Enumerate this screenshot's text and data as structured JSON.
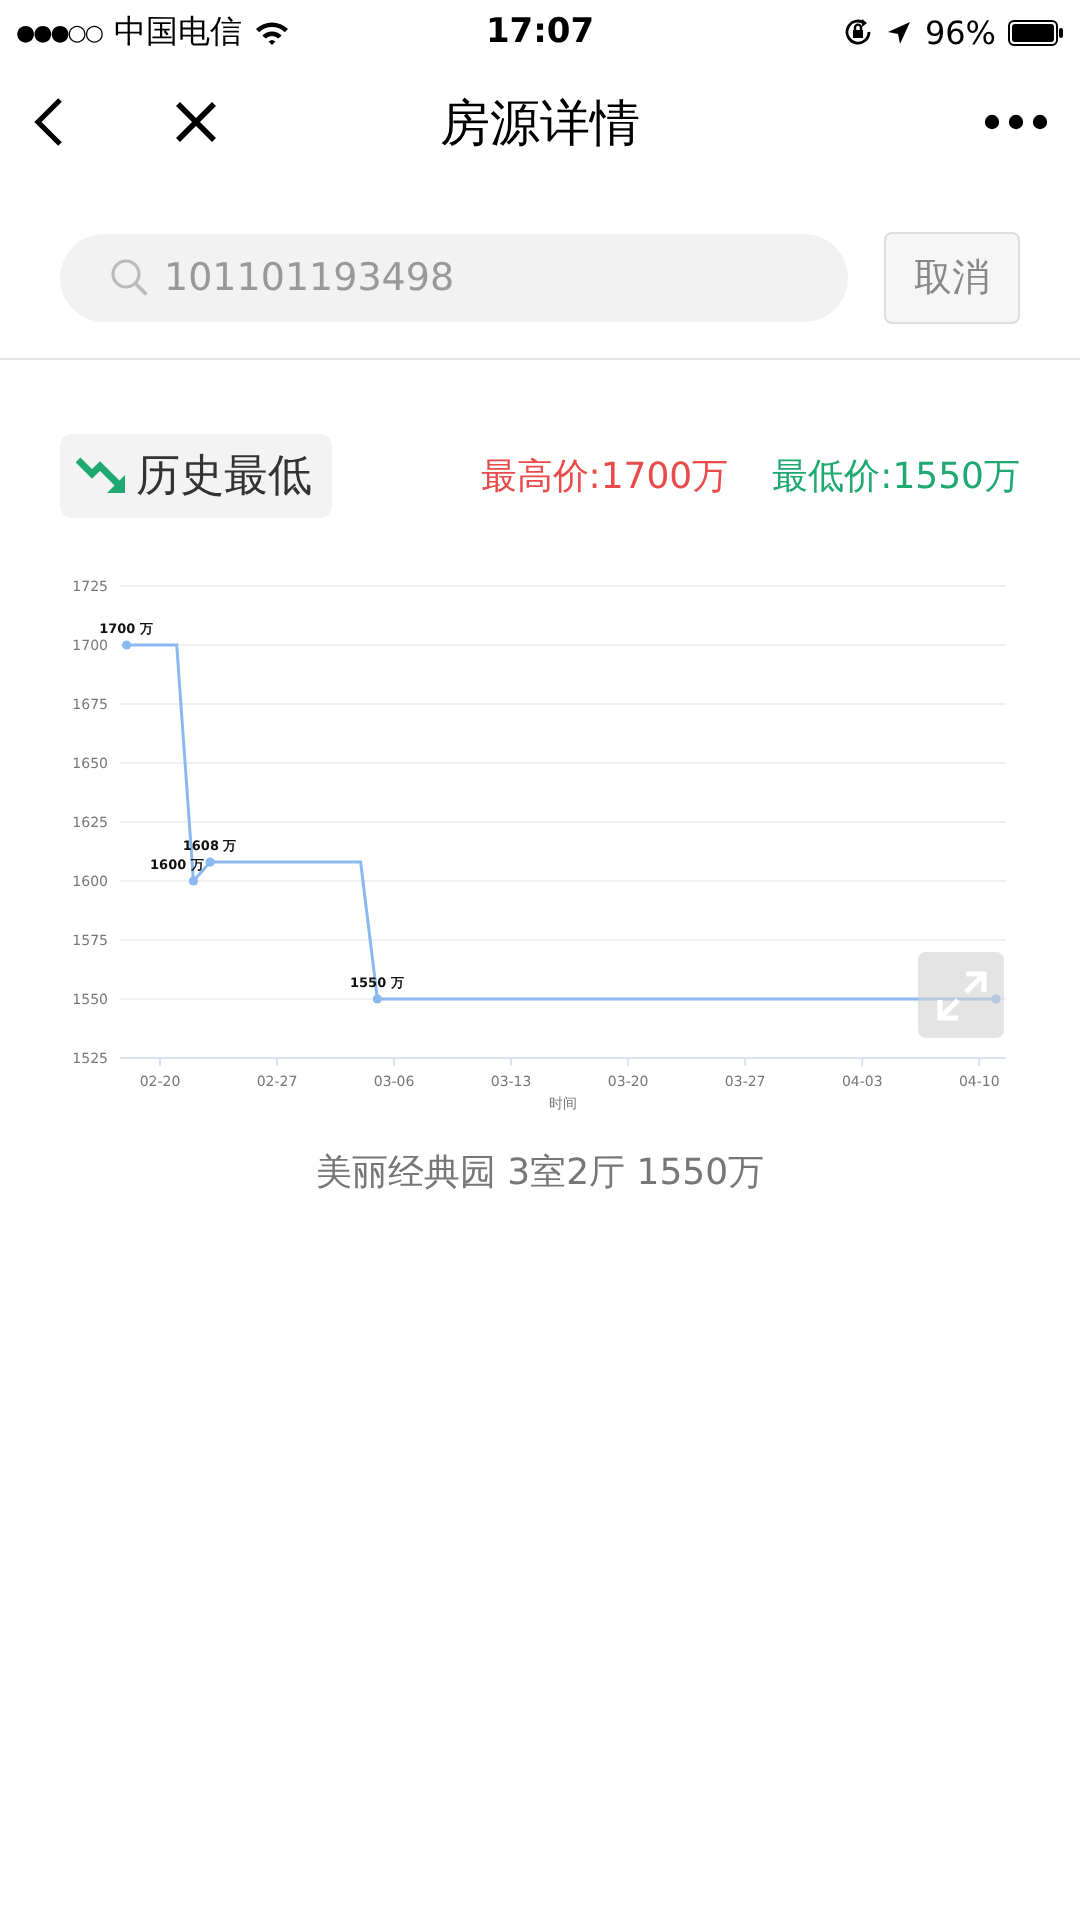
{
  "status_bar": {
    "signal_dots": "●●●○○",
    "carrier": "中国电信",
    "time": "17:07",
    "battery": "96%"
  },
  "nav": {
    "title": "房源详情"
  },
  "search": {
    "value": "101101193498",
    "cancel": "取消"
  },
  "badge": {
    "label": "历史最低"
  },
  "prices": [
    {
      "text": "最高价:1700万",
      "color": "#e94b4b"
    },
    {
      "text": "最低价:1550万",
      "color": "#1fa971"
    }
  ],
  "chart_data": {
    "type": "line",
    "xlabel": "时间",
    "categories": [
      null,
      null,
      "02-20",
      null,
      null,
      null,
      null,
      null,
      null,
      "02-27",
      null,
      null,
      null,
      null,
      null,
      null,
      "03-06",
      null,
      null,
      null,
      null,
      null,
      null,
      "03-13",
      null,
      null,
      null,
      null,
      null,
      null,
      "03-20",
      null,
      null,
      null,
      null,
      null,
      null,
      "03-27",
      null,
      null,
      null,
      null,
      null,
      null,
      "04-03",
      null,
      null,
      null,
      null,
      null,
      null,
      "04-10",
      null
    ],
    "series": [
      {
        "color": "#8ab8ef",
        "values": [
          1700,
          1700,
          1700,
          1700,
          1600,
          1608,
          1608,
          1608,
          1608,
          1608,
          1608,
          1608,
          1608,
          1608,
          1608,
          1550,
          1550,
          1550,
          1550,
          1550,
          1550,
          1550,
          1550,
          1550,
          1550,
          1550,
          1550,
          1550,
          1550,
          1550,
          1550,
          1550,
          1550,
          1550,
          1550,
          1550,
          1550,
          1550,
          1550,
          1550,
          1550,
          1550,
          1550,
          1550,
          1550,
          1550,
          1550,
          1550,
          1550,
          1550,
          1550,
          1550,
          1550
        ]
      }
    ],
    "ylim": [
      1525,
      1725
    ],
    "grid": true,
    "yticks": [
      1525,
      1550,
      1575,
      1600,
      1625,
      1650,
      1675,
      1700,
      1725
    ],
    "value_labels": [
      "1700 万",
      null,
      null,
      null,
      "1600 万",
      "1608 万",
      null,
      null,
      null,
      null,
      null,
      null,
      null,
      null,
      null,
      "1550 万",
      null,
      null,
      null,
      null,
      null,
      null,
      null,
      null,
      null,
      null,
      null,
      null,
      null,
      null,
      null,
      null,
      null,
      null,
      null,
      null,
      null,
      null,
      null,
      null,
      null,
      null,
      null,
      null,
      null,
      null,
      null,
      null,
      null,
      null,
      null,
      null,
      null
    ]
  },
  "caption": "美丽经典园 3室2厅 1550万"
}
